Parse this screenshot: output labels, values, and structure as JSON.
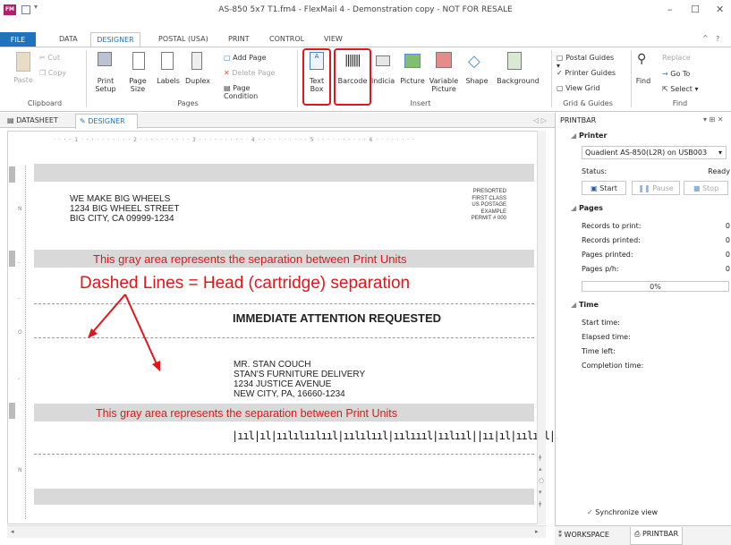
{
  "window": {
    "app_icon": "FM",
    "title": "AS-850 5x7 T1.fm4 - FlexMail 4 - Demonstration copy - NOT FOR RESALE",
    "minimize": "–",
    "maximize": "☐",
    "close": "✕",
    "help": "?"
  },
  "ribbon_tabs": [
    "FILE",
    "DATA",
    "DESIGNER",
    "POSTAL (USA)",
    "PRINT",
    "CONTROL",
    "VIEW"
  ],
  "clipboard": {
    "label": "Clipboard",
    "paste": "Paste",
    "cut": "Cut",
    "copy": "Copy"
  },
  "pages": {
    "label": "Pages",
    "print_setup": "Print Setup",
    "page_size": "Page Size",
    "labels": "Labels",
    "duplex": "Duplex",
    "add_page": "Add Page",
    "delete_page": "Delete Page",
    "page_condition": "Page Condition"
  },
  "insert": {
    "label": "Insert",
    "text_box": "Text Box",
    "barcode": "Barcode",
    "indicia": "Indicia",
    "picture": "Picture",
    "variable_picture": "Variable Picture",
    "shape": "Shape",
    "background": "Background"
  },
  "grid": {
    "label": "Grid & Guides",
    "postal_guides": "Postal Guides",
    "printer_guides": "Printer Guides",
    "view_grid": "View Grid"
  },
  "find": {
    "label": "Find",
    "find": "Find",
    "replace": "Replace",
    "go_to": "Go To",
    "select": "Select"
  },
  "doc_tabs": {
    "datasheet": "DATASHEET",
    "designer": "DESIGNER"
  },
  "ruler": "· · · · 1 · · · · · · · · · · 2 · · · · · · · · · · 3 · · · · · · · · · · 4 · · · · · · · · · · 5 · · · · · · · · · · 6 · · · · · · · ·",
  "ruler_v": [
    "N",
    "-",
    "-",
    "O",
    "-",
    "N"
  ],
  "sender": [
    "WE MAKE BIG WHEELS",
    "1234 BIG WHEEL STREET",
    "BIG CITY, CA 09999-1234"
  ],
  "permit": [
    "PRESORTED",
    "FIRST CLASS",
    "US POSTAGE",
    "EXAMPLE",
    "PERMIT # 000"
  ],
  "gray_note": "This gray area represents the separation between Print Units",
  "dashed_note": "Dashed Lines = Head (cartridge) separation",
  "attention": "IMMEDIATE ATTENTION REQUESTED",
  "recipient": [
    "MR. STAN COUCH",
    "STAN'S FURNITURE DELIVERY",
    "1234 JUSTICE AVENUE",
    "NEW CITY, PA, 16660-1234"
  ],
  "barcode_bars": "|ııl|ıl|ıılılıılııl|ıılılııl|ıılıııl|ıılııl||ıı|ıl|ıılııl|ıııl",
  "panel": {
    "title": "PRINTBAR",
    "printer_heading": "Printer",
    "printer": "Quadient AS-850(L2R) on USB003",
    "status_label": "Status:",
    "status_value": "Ready",
    "start": "Start",
    "pause": "Pause",
    "stop": "Stop",
    "pages_heading": "Pages",
    "rows": [
      {
        "label": "Records to print:",
        "value": "0"
      },
      {
        "label": "Records printed:",
        "value": "0"
      },
      {
        "label": "Pages printed:",
        "value": "0"
      },
      {
        "label": "Pages p/h:",
        "value": "0"
      }
    ],
    "progress": "0%",
    "time_heading": "Time",
    "time_rows": [
      "Start time:",
      "Elapsed time:",
      "Time left:",
      "Completion time:"
    ],
    "sync": "Synchronize view",
    "workspace_tab": "WORKSPACE",
    "printbar_tab": "PRINTBAR"
  }
}
